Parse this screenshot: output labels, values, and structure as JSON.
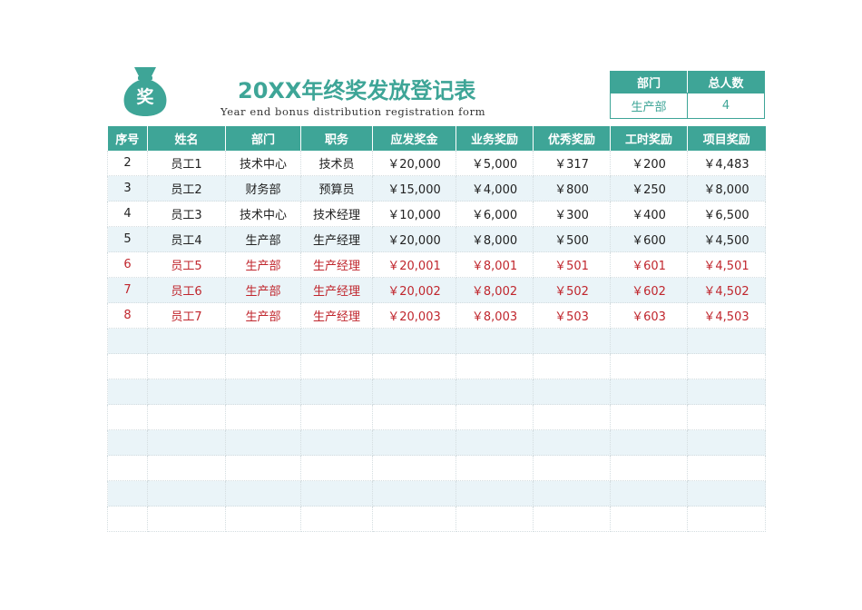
{
  "header": {
    "logo_char": "奖",
    "title": "20XX年终奖发放登记表",
    "subtitle": "Year end bonus distribution registration form"
  },
  "summary": {
    "headers": [
      "部门",
      "总人数"
    ],
    "department": "生产部",
    "total_people": "4"
  },
  "table": {
    "headers": [
      "序号",
      "姓名",
      "部门",
      "职务",
      "应发奖金",
      "业务奖励",
      "优秀奖励",
      "工时奖励",
      "项目奖励"
    ],
    "rows": [
      [
        "2",
        "员工1",
        "技术中心",
        "技术员",
        "￥20,000",
        "￥5,000",
        "￥317",
        "￥200",
        "￥4,483"
      ],
      [
        "3",
        "员工2",
        "财务部",
        "预算员",
        "￥15,000",
        "￥4,000",
        "￥800",
        "￥250",
        "￥8,000"
      ],
      [
        "4",
        "员工3",
        "技术中心",
        "技术经理",
        "￥10,000",
        "￥6,000",
        "￥300",
        "￥400",
        "￥6,500"
      ],
      [
        "5",
        "员工4",
        "生产部",
        "生产经理",
        "￥20,000",
        "￥8,000",
        "￥500",
        "￥600",
        "￥4,500"
      ],
      [
        "6",
        "员工5",
        "生产部",
        "生产经理",
        "￥20,001",
        "￥8,001",
        "￥501",
        "￥601",
        "￥4,501"
      ],
      [
        "7",
        "员工6",
        "生产部",
        "生产经理",
        "￥20,002",
        "￥8,002",
        "￥502",
        "￥602",
        "￥4,502"
      ],
      [
        "8",
        "员工7",
        "生产部",
        "生产经理",
        "￥20,003",
        "￥8,003",
        "￥503",
        "￥603",
        "￥4,503"
      ]
    ],
    "highlighted_rows": [
      4,
      5,
      6
    ],
    "empty_rows": 8
  },
  "colors": {
    "accent": "#3ea597",
    "alt_row": "#eaf4f8",
    "highlight_text": "#c0262d"
  }
}
